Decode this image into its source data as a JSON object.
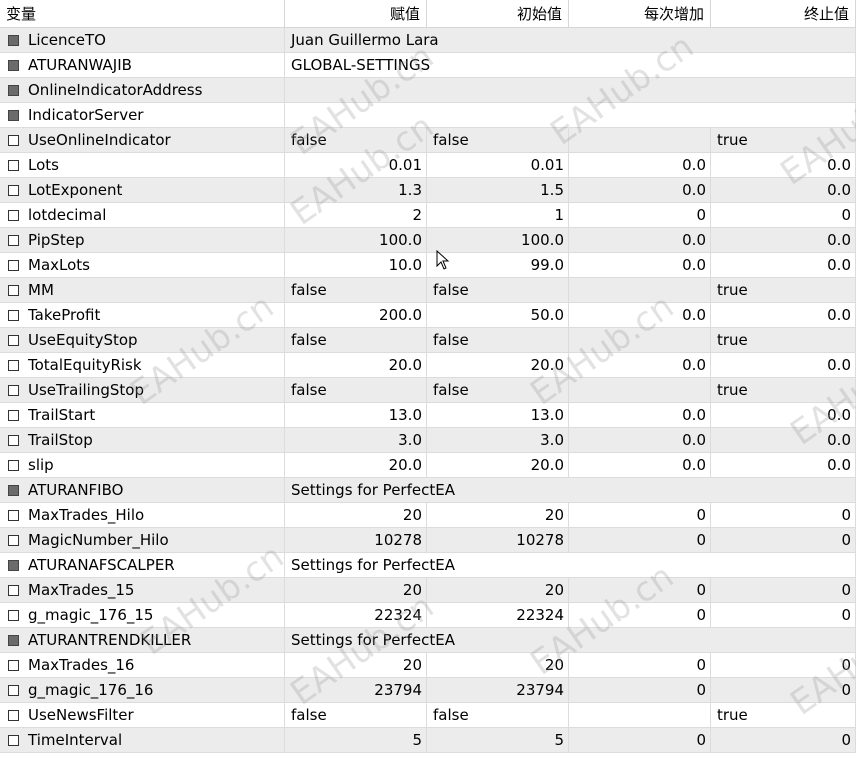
{
  "headers": {
    "variable": "变量",
    "value": "赋值",
    "start": "初始值",
    "step": "每次增加",
    "stop": "终止值"
  },
  "watermark": "EAHub.cn",
  "rows": [
    {
      "name": "LicenceTO",
      "group": true,
      "span": "Juan Guillermo Lara",
      "value": "",
      "start": "",
      "step": "",
      "stop": ""
    },
    {
      "name": "ATURANWAJIB",
      "group": true,
      "span": "GLOBAL-SETTINGS",
      "value": "",
      "start": "",
      "step": "",
      "stop": ""
    },
    {
      "name": "OnlineIndicatorAddress",
      "group": true,
      "span": "",
      "value": "",
      "start": "",
      "step": "",
      "stop": ""
    },
    {
      "name": "IndicatorServer",
      "group": true,
      "span": "",
      "value": "",
      "start": "",
      "step": "",
      "stop": ""
    },
    {
      "name": "UseOnlineIndicator",
      "group": false,
      "bool": true,
      "value": "false",
      "start": "false",
      "step": "",
      "stop": "true"
    },
    {
      "name": "Lots",
      "group": false,
      "value": "0.01",
      "start": "0.01",
      "step": "0.0",
      "stop": "0.0"
    },
    {
      "name": "LotExponent",
      "group": false,
      "value": "1.3",
      "start": "1.5",
      "step": "0.0",
      "stop": "0.0"
    },
    {
      "name": "lotdecimal",
      "group": false,
      "value": "2",
      "start": "1",
      "step": "0",
      "stop": "0"
    },
    {
      "name": "PipStep",
      "group": false,
      "value": "100.0",
      "start": "100.0",
      "step": "0.0",
      "stop": "0.0"
    },
    {
      "name": "MaxLots",
      "group": false,
      "value": "10.0",
      "start": "99.0",
      "step": "0.0",
      "stop": "0.0"
    },
    {
      "name": "MM",
      "group": false,
      "bool": true,
      "value": "false",
      "start": "false",
      "step": "",
      "stop": "true"
    },
    {
      "name": "TakeProfit",
      "group": false,
      "value": "200.0",
      "start": "50.0",
      "step": "0.0",
      "stop": "0.0"
    },
    {
      "name": "UseEquityStop",
      "group": false,
      "bool": true,
      "value": "false",
      "start": "false",
      "step": "",
      "stop": "true"
    },
    {
      "name": "TotalEquityRisk",
      "group": false,
      "value": "20.0",
      "start": "20.0",
      "step": "0.0",
      "stop": "0.0"
    },
    {
      "name": "UseTrailingStop",
      "group": false,
      "bool": true,
      "value": "false",
      "start": "false",
      "step": "",
      "stop": "true"
    },
    {
      "name": "TrailStart",
      "group": false,
      "value": "13.0",
      "start": "13.0",
      "step": "0.0",
      "stop": "0.0"
    },
    {
      "name": "TrailStop",
      "group": false,
      "value": "3.0",
      "start": "3.0",
      "step": "0.0",
      "stop": "0.0"
    },
    {
      "name": "slip",
      "group": false,
      "value": "20.0",
      "start": "20.0",
      "step": "0.0",
      "stop": "0.0"
    },
    {
      "name": "ATURANFIBO",
      "group": true,
      "span": "Settings for PerfectEA",
      "value": "",
      "start": "",
      "step": "",
      "stop": ""
    },
    {
      "name": "MaxTrades_Hilo",
      "group": false,
      "value": "20",
      "start": "20",
      "step": "0",
      "stop": "0"
    },
    {
      "name": "MagicNumber_Hilo",
      "group": false,
      "value": "10278",
      "start": "10278",
      "step": "0",
      "stop": "0"
    },
    {
      "name": "ATURANAFSCALPER",
      "group": true,
      "span": "Settings for PerfectEA",
      "value": "",
      "start": "",
      "step": "",
      "stop": ""
    },
    {
      "name": "MaxTrades_15",
      "group": false,
      "value": "20",
      "start": "20",
      "step": "0",
      "stop": "0"
    },
    {
      "name": "g_magic_176_15",
      "group": false,
      "value": "22324",
      "start": "22324",
      "step": "0",
      "stop": "0"
    },
    {
      "name": "ATURANTRENDKILLER",
      "group": true,
      "span": "Settings for PerfectEA",
      "value": "",
      "start": "",
      "step": "",
      "stop": ""
    },
    {
      "name": "MaxTrades_16",
      "group": false,
      "value": "20",
      "start": "20",
      "step": "0",
      "stop": "0"
    },
    {
      "name": "g_magic_176_16",
      "group": false,
      "value": "23794",
      "start": "23794",
      "step": "0",
      "stop": "0"
    },
    {
      "name": "UseNewsFilter",
      "group": false,
      "bool": true,
      "value": "false",
      "start": "false",
      "step": "",
      "stop": "true"
    },
    {
      "name": "TimeInterval",
      "group": false,
      "value": "5",
      "start": "5",
      "step": "0",
      "stop": "0"
    }
  ]
}
